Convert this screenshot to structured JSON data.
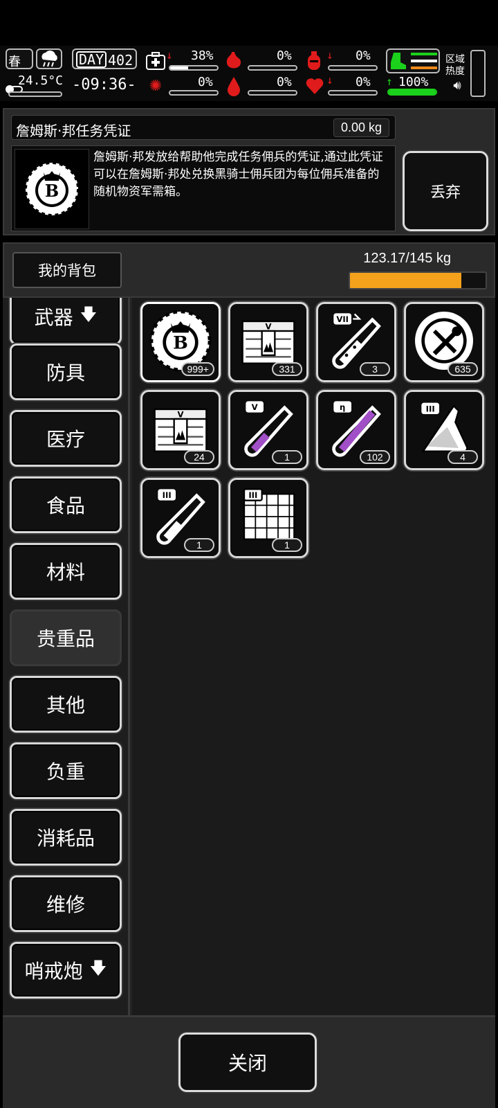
{
  "status": {
    "season": "春",
    "temperature": "24.5°C",
    "day_label": "DAY",
    "day_number": "402",
    "time": "-09:36-",
    "health_pct": "38%",
    "hunger_pct": "0%",
    "thirst_pct": "0%",
    "infection_pct": "0%",
    "bleed_pct": "0%",
    "heart_pct": "0%",
    "stamina_pct": "100%",
    "zone_label": "区域热度",
    "health_level": 0.38,
    "stamina_level": 1.0,
    "colors": {
      "alert": "#e01b1b",
      "stamina": "#1bd11b",
      "orange": "#f08a1b"
    }
  },
  "item": {
    "name": "詹姆斯·邦任务凭证",
    "weight": "0.00 kg",
    "description": "詹姆斯·邦发放给帮助他完成任务佣兵的凭证,通过此凭证可以在詹姆斯·邦处兑换黑骑士佣兵团为每位佣兵准备的随机物资军需箱。",
    "icon": "token-b-coin-icon",
    "discard_label": "丢弃"
  },
  "bag": {
    "label": "我的背包",
    "weight": "123.17/145 kg",
    "fill_level": 0.82,
    "bar_color": "#f4a11b"
  },
  "categories": [
    {
      "label": "武器",
      "arrow": "🡇"
    },
    {
      "label": "防具"
    },
    {
      "label": "医疗"
    },
    {
      "label": "食品"
    },
    {
      "label": "材料"
    },
    {
      "label": "贵重品",
      "active": true
    },
    {
      "label": "其他"
    },
    {
      "label": "负重"
    },
    {
      "label": "消耗品"
    },
    {
      "label": "维修"
    },
    {
      "label": "哨戒炮",
      "arrow": "🡇"
    }
  ],
  "items": [
    {
      "icon": "token-b-coin-icon",
      "count": "999+"
    },
    {
      "icon": "supply-crate-icon",
      "count": "331"
    },
    {
      "icon": "test-tube-vii-icon",
      "count": "3"
    },
    {
      "icon": "repair-coin-icon",
      "count": "635"
    },
    {
      "icon": "supply-crate-icon",
      "count": "24"
    },
    {
      "icon": "test-tube-v-purple-icon",
      "count": "1"
    },
    {
      "icon": "test-tube-n-purple-icon",
      "count": "102"
    },
    {
      "icon": "flask-iii-icon",
      "count": "4"
    },
    {
      "icon": "test-tube-iii-icon",
      "count": "1"
    },
    {
      "icon": "blueprint-iii-icon",
      "count": "1"
    }
  ],
  "close_label": "关闭"
}
